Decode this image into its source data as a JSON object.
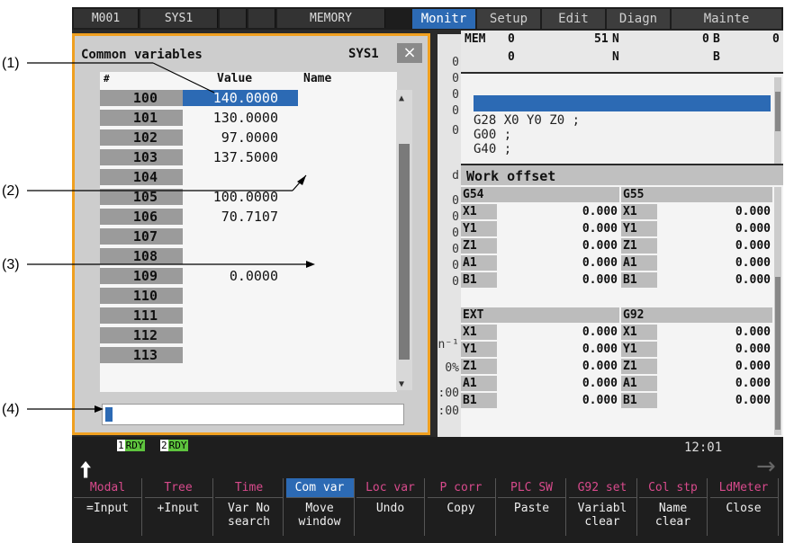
{
  "topbar": {
    "cells": [
      "M001",
      "SYS1",
      "",
      "",
      "MEMORY"
    ],
    "tabs": [
      "Monitr",
      "Setup",
      "Edit",
      "Diagn",
      "Mainte"
    ],
    "active_tab": "Monitr"
  },
  "mem_panel": {
    "row1": [
      "MEM",
      "0",
      "51",
      "N",
      "0",
      "B",
      "0"
    ],
    "row2": [
      "0",
      "N",
      "B"
    ]
  },
  "program": {
    "lines": [
      "G28 X0 Y0 Z0 ;",
      "G00 ;",
      "G40 ;"
    ]
  },
  "behind_fragments": [
    "0",
    "0",
    "0",
    "0",
    "0",
    "d",
    "0",
    "0",
    "0",
    "0",
    "0",
    "0",
    "n⁻¹",
    "0%",
    ":00",
    ":00"
  ],
  "work_offset": {
    "title": "Work offset",
    "group1": {
      "left": "G54",
      "right": "G55"
    },
    "group2": {
      "left": "EXT",
      "right": "G92"
    },
    "axes": [
      "X1",
      "Y1",
      "Z1",
      "A1",
      "B1"
    ],
    "value": "0.000"
  },
  "common_variables": {
    "title": "Common variables",
    "system": "SYS1",
    "close_label": "×",
    "headers": {
      "num": "#",
      "value": "Value",
      "name": "Name"
    },
    "rows": [
      {
        "num": "100",
        "value": "140.0000",
        "selected": true
      },
      {
        "num": "101",
        "value": "130.0000"
      },
      {
        "num": "102",
        "value": "97.0000"
      },
      {
        "num": "103",
        "value": "137.5000"
      },
      {
        "num": "104",
        "value": ""
      },
      {
        "num": "105",
        "value": "100.0000"
      },
      {
        "num": "106",
        "value": "70.7107"
      },
      {
        "num": "107",
        "value": ""
      },
      {
        "num": "108",
        "value": ""
      },
      {
        "num": "109",
        "value": "0.0000"
      },
      {
        "num": "110",
        "value": ""
      },
      {
        "num": "111",
        "value": ""
      },
      {
        "num": "112",
        "value": ""
      },
      {
        "num": "113",
        "value": ""
      }
    ]
  },
  "status": {
    "rdy1": {
      "num": "1",
      "text": "RDY"
    },
    "rdy2": {
      "num": "2",
      "text": "RDY"
    },
    "clock": "12:01"
  },
  "menu": [
    {
      "up": "Modal",
      "lo": "=Input"
    },
    {
      "up": "Tree",
      "lo": "+Input"
    },
    {
      "up": "Time",
      "lo": "Var No\nsearch"
    },
    {
      "up": "Com var",
      "lo": "Move\nwindow",
      "active": true
    },
    {
      "up": "Loc var",
      "lo": "Undo"
    },
    {
      "up": "P corr",
      "lo": "Copy"
    },
    {
      "up": "PLC SW",
      "lo": "Paste"
    },
    {
      "up": "G92 set",
      "lo": "Variabl\nclear"
    },
    {
      "up": "Col stp",
      "lo": "Name\nclear"
    },
    {
      "up": "LdMeter",
      "lo": "Close"
    }
  ],
  "callouts": [
    "(1)",
    "(2)",
    "(3)",
    "(4)"
  ],
  "colors": {
    "accent": "#2c6ab4",
    "window_border": "#f0a020",
    "menu_text": "#d84a8c",
    "ready": "#5ec43e"
  }
}
